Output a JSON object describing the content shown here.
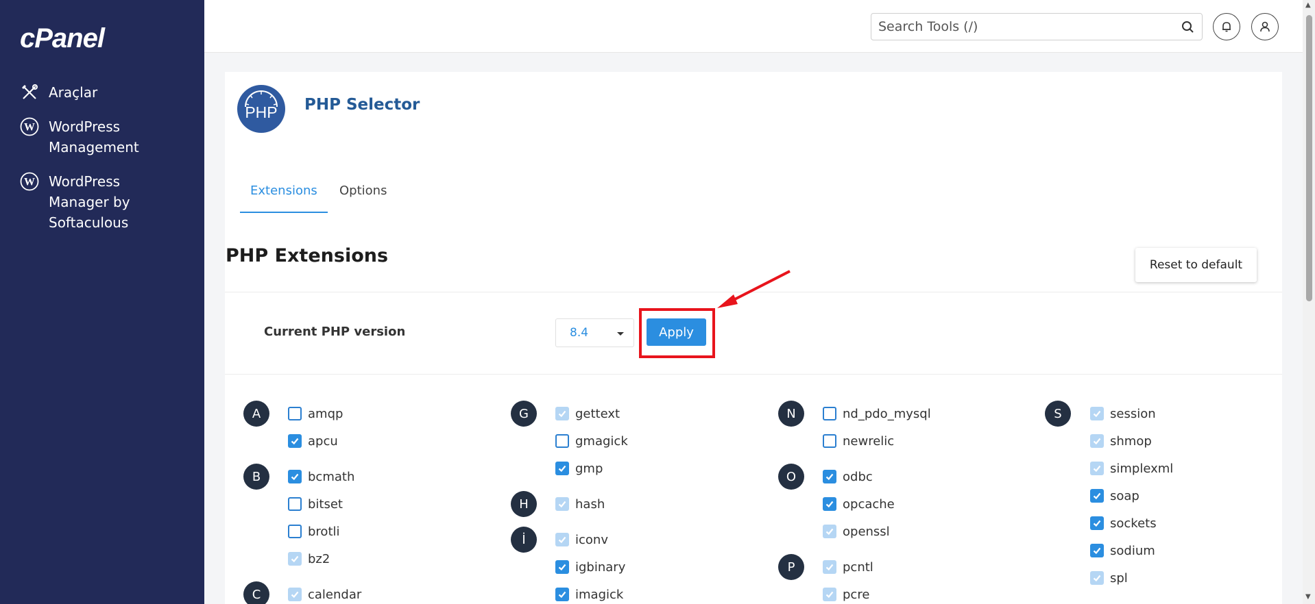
{
  "sidebar": {
    "logo": "cPanel",
    "items": [
      {
        "icon": "tools-icon",
        "label": "Araçlar"
      },
      {
        "icon": "wordpress-icon",
        "label": "WordPress\nManagement"
      },
      {
        "icon": "wordpress-icon",
        "label": "WordPress\nManager by\nSoftaculous"
      }
    ]
  },
  "topbar": {
    "search_placeholder": "Search Tools (/)",
    "icons": [
      "search-icon",
      "bell-icon",
      "user-icon"
    ]
  },
  "page": {
    "title": "PHP Selector",
    "logo_text": "PHP",
    "tabs": [
      {
        "label": "Extensions",
        "active": true
      },
      {
        "label": "Options",
        "active": false
      }
    ],
    "section_title": "PHP Extensions",
    "reset_label": "Reset to default",
    "version_label": "Current PHP version",
    "version_value": "8.4",
    "apply_label": "Apply"
  },
  "colors": {
    "sidebar": "#222a58",
    "accent": "#2b8ee0",
    "highlight": "#e8141c",
    "title": "#245a96"
  },
  "extensions": [
    {
      "letter": "A",
      "items": [
        {
          "name": "amqp",
          "state": "off"
        },
        {
          "name": "apcu",
          "state": "on"
        }
      ]
    },
    {
      "letter": "B",
      "items": [
        {
          "name": "bcmath",
          "state": "on"
        },
        {
          "name": "bitset",
          "state": "off"
        },
        {
          "name": "brotli",
          "state": "off"
        },
        {
          "name": "bz2",
          "state": "disabled"
        }
      ]
    },
    {
      "letter": "C",
      "items": [
        {
          "name": "calendar",
          "state": "disabled"
        }
      ]
    },
    {
      "letter": "G",
      "items": [
        {
          "name": "gettext",
          "state": "disabled"
        },
        {
          "name": "gmagick",
          "state": "off"
        },
        {
          "name": "gmp",
          "state": "on"
        }
      ]
    },
    {
      "letter": "H",
      "items": [
        {
          "name": "hash",
          "state": "disabled"
        }
      ]
    },
    {
      "letter": "İ",
      "items": [
        {
          "name": "iconv",
          "state": "disabled"
        },
        {
          "name": "igbinary",
          "state": "on"
        },
        {
          "name": "imagick",
          "state": "on"
        }
      ]
    },
    {
      "letter": "N",
      "items": [
        {
          "name": "nd_pdo_mysql",
          "state": "off"
        },
        {
          "name": "newrelic",
          "state": "off"
        }
      ]
    },
    {
      "letter": "O",
      "items": [
        {
          "name": "odbc",
          "state": "on"
        },
        {
          "name": "opcache",
          "state": "on"
        },
        {
          "name": "openssl",
          "state": "disabled"
        }
      ]
    },
    {
      "letter": "P",
      "items": [
        {
          "name": "pcntl",
          "state": "disabled"
        },
        {
          "name": "pcre",
          "state": "disabled"
        }
      ]
    },
    {
      "letter": "S",
      "items": [
        {
          "name": "session",
          "state": "disabled"
        },
        {
          "name": "shmop",
          "state": "disabled"
        },
        {
          "name": "simplexml",
          "state": "disabled"
        },
        {
          "name": "soap",
          "state": "on"
        },
        {
          "name": "sockets",
          "state": "on"
        },
        {
          "name": "sodium",
          "state": "on"
        },
        {
          "name": "spl",
          "state": "disabled"
        }
      ]
    }
  ]
}
